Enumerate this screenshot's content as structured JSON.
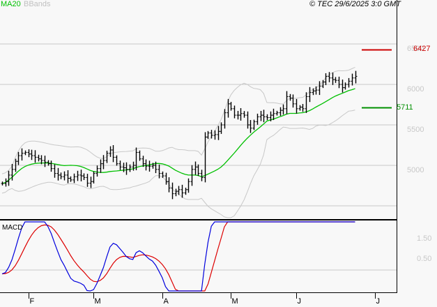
{
  "header": {
    "legend_ma": "MA20",
    "legend_bbands": "BBands",
    "copyright": "© TEC 29/6/2025 3:0 GMT"
  },
  "colors": {
    "ma": "#00c000",
    "bbands": "#c8c8c8",
    "bars": "#000000",
    "resistance": "#cc0000",
    "support": "#009000",
    "macd": "#0000dd",
    "signal": "#dd0000"
  },
  "chart_data": {
    "type": "line",
    "title": "Price bars with MA20, Bollinger Bands and MACD",
    "price_axis": {
      "ylim": [
        4400,
        6900
      ],
      "ticks": [
        "6500",
        "6000",
        "5500",
        "5000"
      ],
      "tick_values": [
        6500,
        6000,
        5500,
        5000
      ],
      "gridlines": [
        6500,
        6000,
        5500,
        5000,
        4500
      ]
    },
    "x_labels": [
      "F",
      "M",
      "A",
      "M",
      "J",
      "J"
    ],
    "x_label_index": [
      8,
      28,
      49,
      70,
      90,
      114
    ],
    "closes": [
      4776,
      4800,
      4880,
      4950,
      5050,
      5120,
      5150,
      5160,
      5140,
      5120,
      5100,
      5080,
      5060,
      5040,
      5020,
      4960,
      4900,
      4880,
      4860,
      4880,
      4840,
      4820,
      4860,
      4880,
      4870,
      4850,
      4780,
      4800,
      4900,
      4960,
      5020,
      5060,
      5150,
      5190,
      5100,
      5020,
      4980,
      4970,
      4950,
      4980,
      5000,
      5160,
      5080,
      5020,
      4990,
      4990,
      5000,
      4950,
      4900,
      4870,
      4800,
      4720,
      4650,
      4680,
      4700,
      4660,
      4700,
      4800,
      4950,
      4980,
      4900,
      4850,
      5350,
      5400,
      5370,
      5380,
      5420,
      5500,
      5650,
      5760,
      5700,
      5620,
      5620,
      5640,
      5620,
      5500,
      5460,
      5540,
      5600,
      5620,
      5600,
      5590,
      5620,
      5640,
      5650,
      5680,
      5700,
      5850,
      5830,
      5760,
      5700,
      5720,
      5700,
      5850,
      5900,
      5920,
      5930,
      5980,
      6030,
      6100,
      6080,
      6060,
      6050,
      6000,
      5960,
      6000,
      6040,
      6080,
      6100
    ],
    "levels": [
      {
        "name": "resistance",
        "value": 6427,
        "label": "6427"
      },
      {
        "name": "support",
        "value": 5711,
        "label": "5711"
      }
    ],
    "macd_axis": {
      "ticks": [
        "1.50",
        "0.50"
      ],
      "tick_values": [
        1.5,
        0.5
      ],
      "title": "MACD"
    }
  }
}
